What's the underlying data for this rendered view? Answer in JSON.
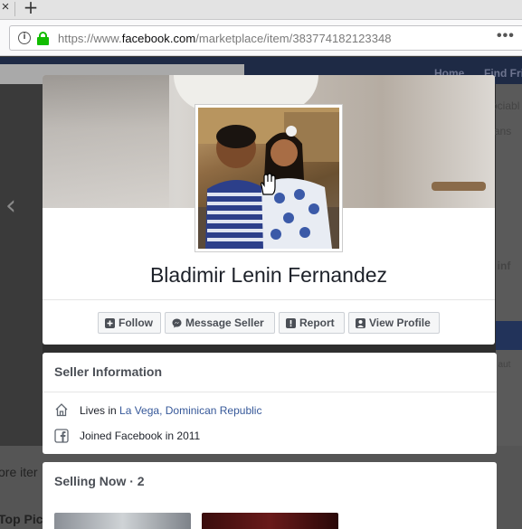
{
  "browser": {
    "url_prefix": "https://www.",
    "url_domain": "facebook.com",
    "url_path": "/marketplace/item/383774182123348",
    "tab_close_glyph": "×",
    "new_tab_glyph": "+",
    "more_glyph": "•••",
    "info_glyph": "i"
  },
  "background": {
    "nav_items": [
      "Home",
      "Find Fri"
    ],
    "right_texts": [
      "Sociabl",
      "Trans",
      "er inf",
      "lite aut"
    ],
    "bottom_texts": [
      "ore iter",
      "Top Pic"
    ],
    "prev_glyph": "‹"
  },
  "profile": {
    "name": "Bladimir Lenin Fernandez"
  },
  "actions": {
    "follow": "Follow",
    "message": "Message Seller",
    "report": "Report",
    "view_profile": "View Profile"
  },
  "seller_info": {
    "title": "Seller Information",
    "lives_prefix": "Lives in ",
    "location": "La Vega, Dominican Republic",
    "joined": "Joined Facebook in 2011"
  },
  "selling_now": {
    "title": "Selling Now · 2"
  },
  "colors": {
    "fb_blue": "#365899",
    "lock_green": "#12bc00",
    "text_dark": "#1d2129",
    "button_bg": "#f5f6f7"
  },
  "icons": [
    "info-icon",
    "lock-icon",
    "more-icon",
    "follow-icon",
    "messenger-icon",
    "report-icon",
    "profile-icon",
    "home-icon",
    "facebook-icon",
    "hand-cursor-icon"
  ]
}
